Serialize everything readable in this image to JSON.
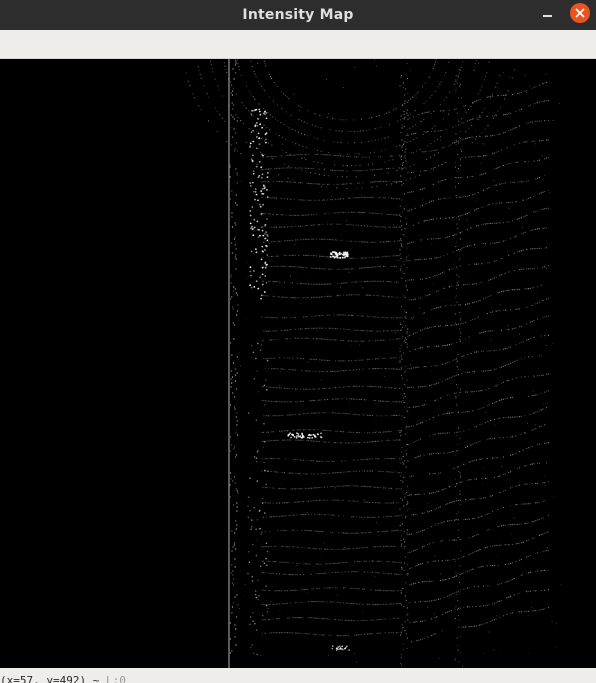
{
  "window": {
    "title": "Intensity Map",
    "minimize_label": "–",
    "close_icon": "close-icon"
  },
  "colors": {
    "titlebar": "#2d2d2d",
    "close_button": "#e95420",
    "toolbar": "#efedea",
    "canvas": "#000000",
    "points": "#ffffff"
  },
  "statusbar": {
    "coords": "(x=57, y=492) ~",
    "value": "L:0"
  }
}
